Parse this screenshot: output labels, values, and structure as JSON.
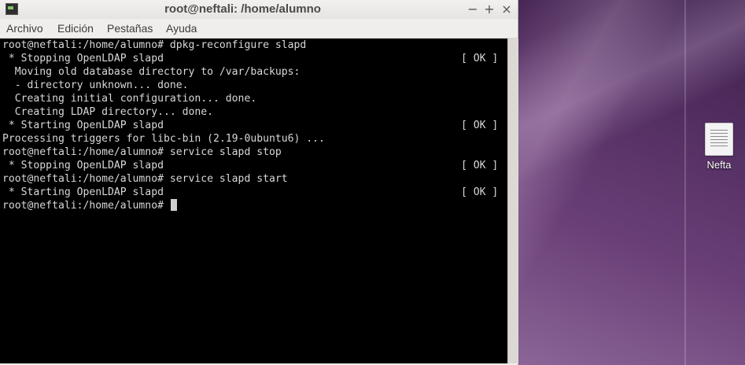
{
  "window": {
    "title": "root@neftali: /home/alumno",
    "controls": {
      "minimize": "−",
      "maximize": "+",
      "close": "×"
    }
  },
  "menu": [
    "Archivo",
    "Edición",
    "Pestañas",
    "Ayuda"
  ],
  "terminal": {
    "lines": [
      "root@neftali:/home/alumno# dpkg-reconfigure slapd",
      " * Stopping OpenLDAP slapd",
      "  Moving old database directory to /var/backups:",
      "  - directory unknown... done.",
      "  Creating initial configuration... done.",
      "  Creating LDAP directory... done.",
      " * Starting OpenLDAP slapd",
      "Processing triggers for libc-bin (2.19-0ubuntu6) ...",
      "root@neftali:/home/alumno# service slapd stop",
      " * Stopping OpenLDAP slapd",
      "root@neftali:/home/alumno# service slapd start",
      " * Starting OpenLDAP slapd",
      "root@neftali:/home/alumno# "
    ],
    "status_ok": "[ OK ]"
  },
  "desktop": {
    "icon_label": "Nefta",
    "icon_name": "text-document-icon"
  }
}
